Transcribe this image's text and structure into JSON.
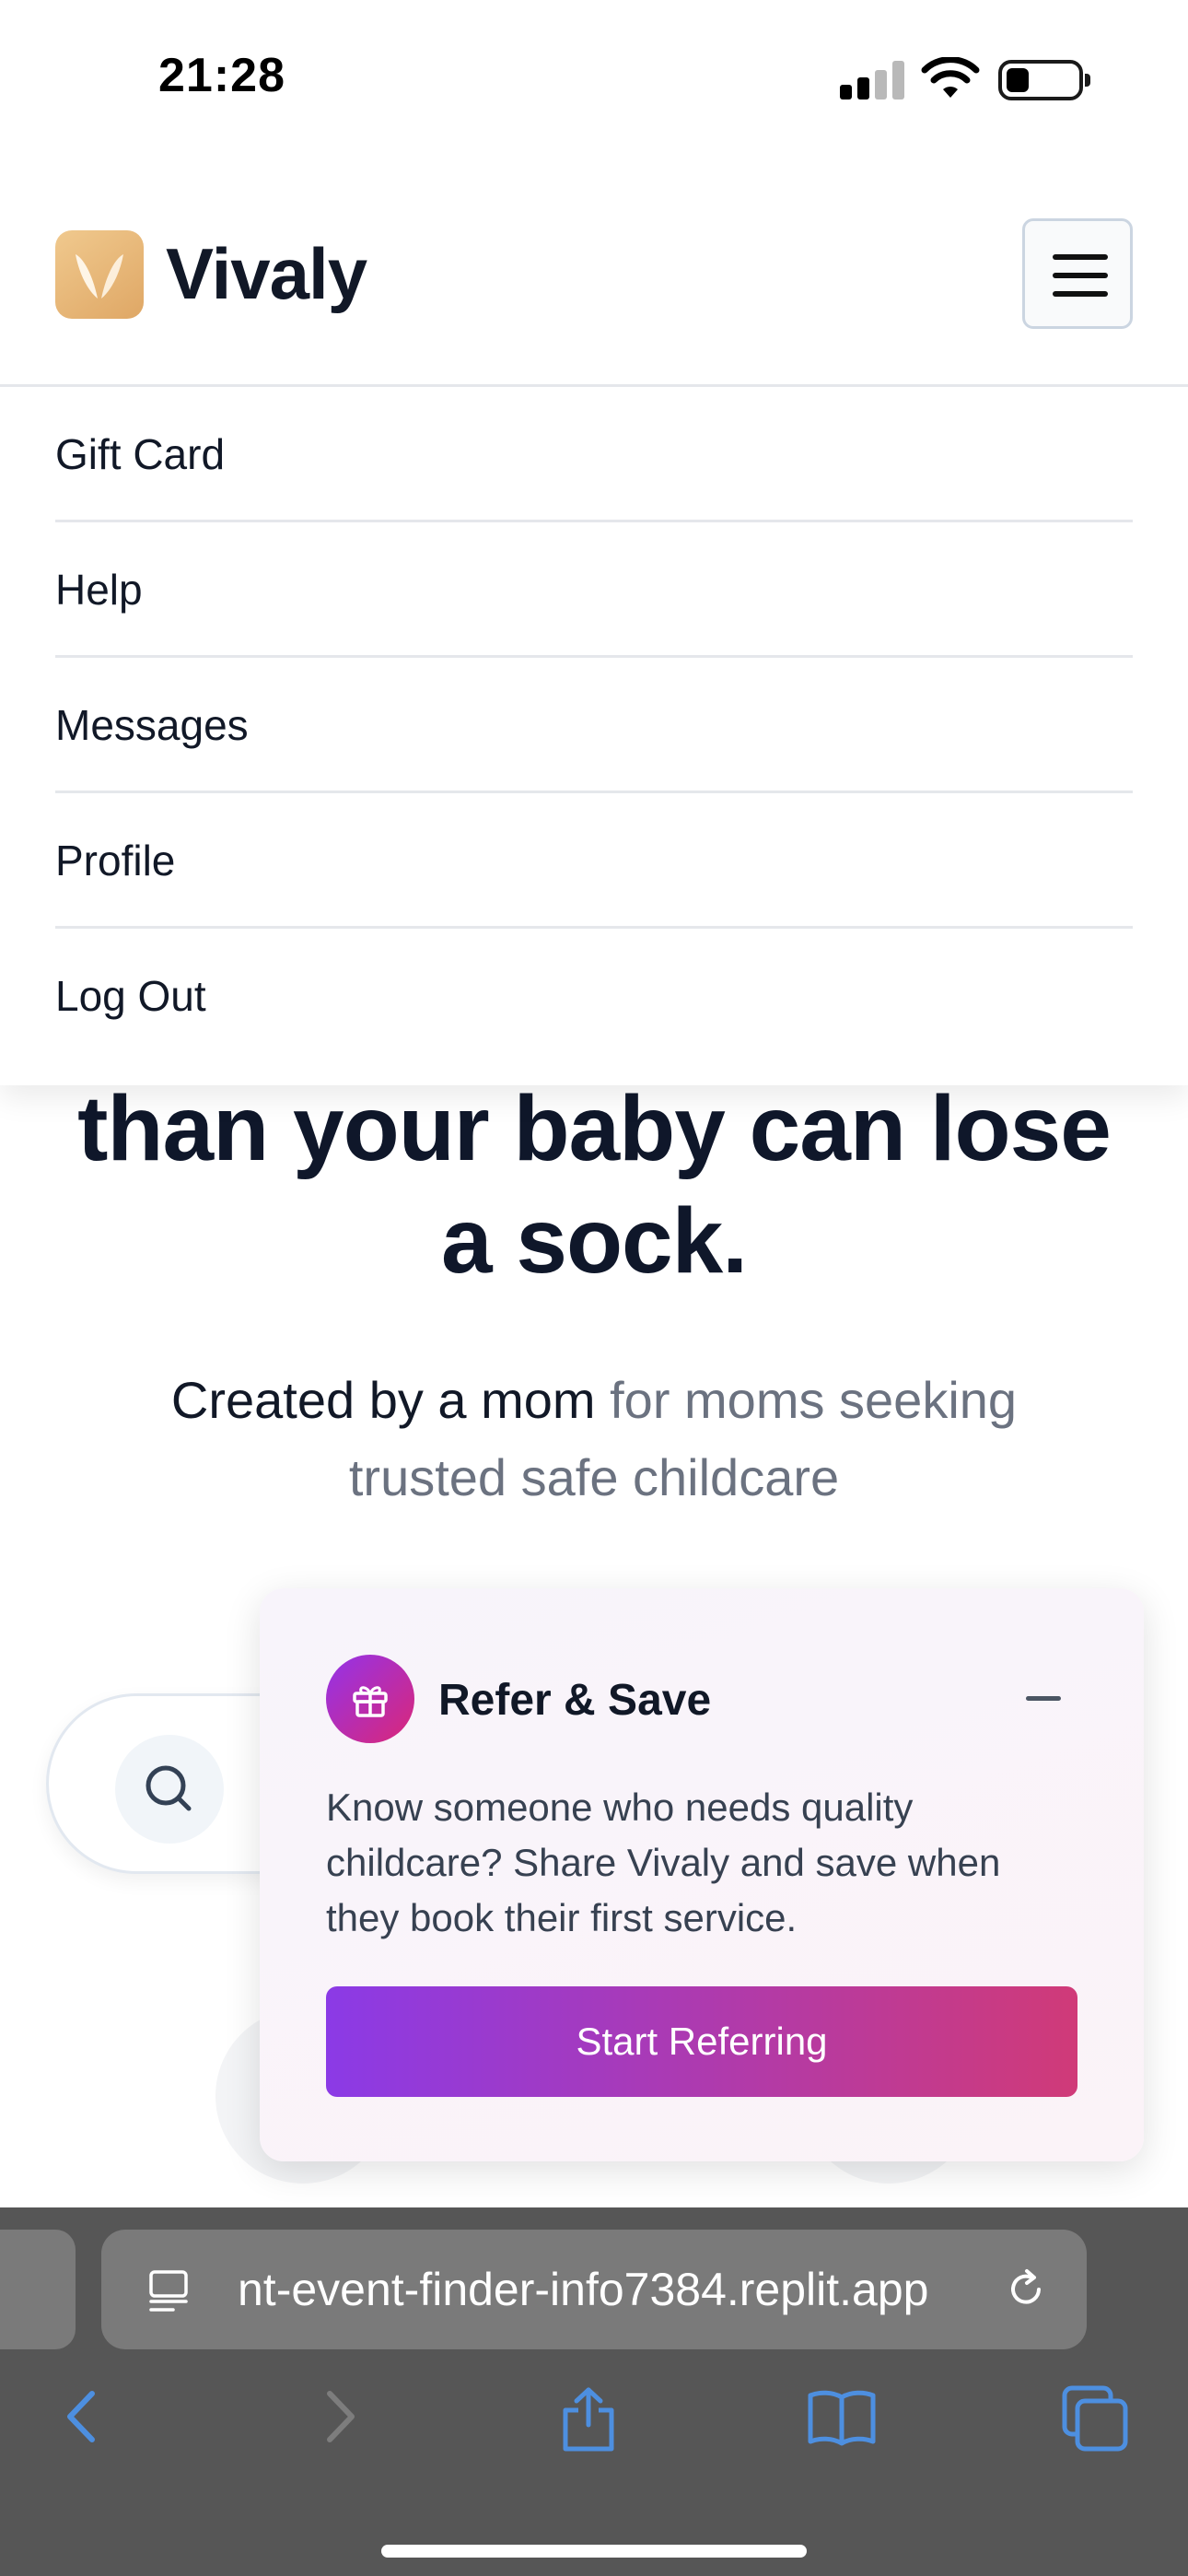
{
  "status_bar": {
    "time": "21:28"
  },
  "header": {
    "brand": "Vivaly"
  },
  "menu": {
    "items": [
      {
        "label": "Gift Card"
      },
      {
        "label": "Help"
      },
      {
        "label": "Messages"
      },
      {
        "label": "Profile"
      },
      {
        "label": "Log Out"
      }
    ]
  },
  "hero": {
    "line1": "than your baby can lose",
    "line2": "a sock.",
    "sub_strong": "Created by a mom",
    "sub_rest": " for moms seeking trusted safe childcare"
  },
  "referral": {
    "title": "Refer & Save",
    "body": "Know someone who needs quality childcare? Share Vivaly and save when they book their first service.",
    "cta": "Start Referring"
  },
  "browser": {
    "url": "nt-event-finder-info7384.replit.app"
  },
  "colors": {
    "brand_gold": "#e8b877",
    "cta_start": "#8b3ae6",
    "cta_end": "#d03a78",
    "browser_blue": "#4d8fe0"
  }
}
